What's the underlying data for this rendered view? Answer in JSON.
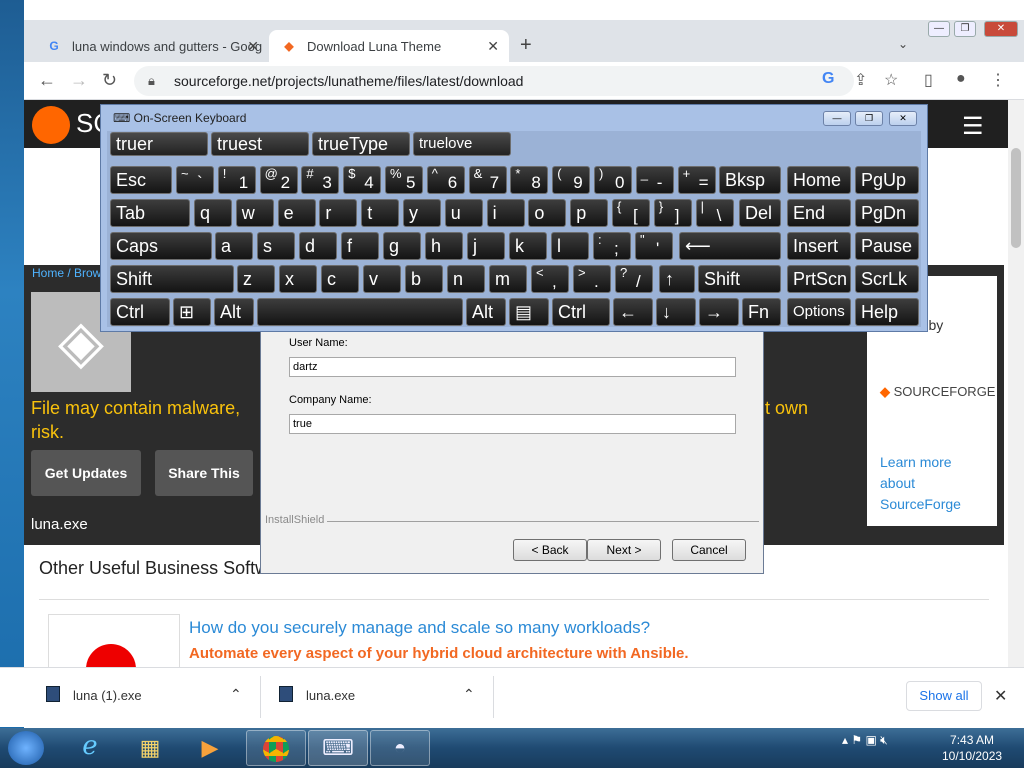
{
  "browser": {
    "tabs": [
      {
        "title": "luna windows and gutters - Goog",
        "favicon": "google-icon"
      },
      {
        "title": "Download Luna Theme",
        "favicon": "sourceforge-icon"
      }
    ],
    "url": "sourceforge.net/projects/lunatheme/files/latest/download"
  },
  "page": {
    "logo_text": "SC",
    "breadcrumbs": "Home / Brow",
    "warning_line1": "File may contain malware,",
    "warning_line2": "risk.",
    "warning_tail": "t own",
    "get_updates": "Get Updates",
    "share_this": "Share This",
    "filename": "luna.exe",
    "ad_by": "ed by",
    "ad_logo_1": "SOURCE",
    "ad_logo_2": "FORGE",
    "ad_learn": "Learn more about SourceForge",
    "other_heading": "Other Useful Business Softw",
    "promo_question": "How do you securely manage and scale so many workloads?",
    "promo_tagline": "Automate every aspect of your hybrid cloud architecture with Ansible."
  },
  "dialog": {
    "user_label": "User Name:",
    "user_value": "dartz",
    "company_label": "Company Name:",
    "company_value": "true",
    "brand": "InstallShield",
    "back": "< Back",
    "next": "Next >",
    "cancel": "Cancel"
  },
  "osk": {
    "title": "On-Screen Keyboard",
    "predictions": [
      "truer",
      "truest",
      "trueType",
      "truelove"
    ],
    "keys": {
      "esc": "Esc",
      "bksp": "Bksp",
      "home": "Home",
      "pgup": "PgUp",
      "tab": "Tab",
      "del": "Del",
      "end": "End",
      "pgdn": "PgDn",
      "caps": "Caps",
      "insert": "Insert",
      "pause": "Pause",
      "shift": "Shift",
      "prtscn": "PrtScn",
      "scrlk": "ScrLk",
      "ctrl": "Ctrl",
      "alt": "Alt",
      "fn": "Fn",
      "options": "Options",
      "help": "Help"
    },
    "row1": [
      [
        "~",
        "`"
      ],
      [
        "!",
        "1"
      ],
      [
        "@",
        "2"
      ],
      [
        "#",
        "3"
      ],
      [
        "$",
        "4"
      ],
      [
        "%",
        "5"
      ],
      [
        "^",
        "6"
      ],
      [
        "&",
        "7"
      ],
      [
        "*",
        "8"
      ],
      [
        "(",
        "9"
      ],
      [
        ")",
        "0"
      ],
      [
        "_",
        "-"
      ],
      [
        "+",
        "="
      ]
    ],
    "row2": [
      "q",
      "w",
      "e",
      "r",
      "t",
      "y",
      "u",
      "i",
      "o",
      "p",
      [
        "{",
        "["
      ],
      [
        "}",
        "]"
      ],
      [
        "|",
        "\\"
      ]
    ],
    "row3": [
      "a",
      "s",
      "d",
      "f",
      "g",
      "h",
      "j",
      "k",
      "l",
      [
        ":",
        ";"
      ],
      [
        "\"",
        "'"
      ]
    ],
    "row4": [
      "z",
      "x",
      "c",
      "v",
      "b",
      "n",
      "m",
      [
        "<",
        ","
      ],
      [
        ">",
        "."
      ],
      [
        "?",
        "/"
      ]
    ]
  },
  "downloads": {
    "items": [
      "luna (1).exe",
      "luna.exe"
    ],
    "show_all": "Show all"
  },
  "taskbar": {
    "time": "7:43 AM",
    "date": "10/10/2023"
  }
}
